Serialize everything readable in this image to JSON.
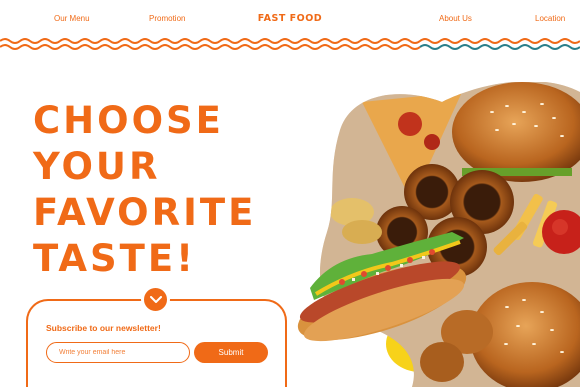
{
  "nav": {
    "items": [
      "Our Menu",
      "Promotion",
      "About Us",
      "Location"
    ],
    "brand": "FAST FOOD"
  },
  "hero": {
    "headline": [
      "CHOOSE",
      "YOUR",
      "FAVORITE",
      "TASTE!"
    ]
  },
  "newsletter": {
    "title": "Subscribe to our newsletter!",
    "email_placeholder": "Write your email here",
    "email_value": "",
    "submit_label": "Submit"
  },
  "colors": {
    "accent": "#f06a17",
    "wave_secondary": "#2a7f8a",
    "yellow": "#f7d21a"
  },
  "icons": {
    "scroll": "chevron-down-icon"
  }
}
